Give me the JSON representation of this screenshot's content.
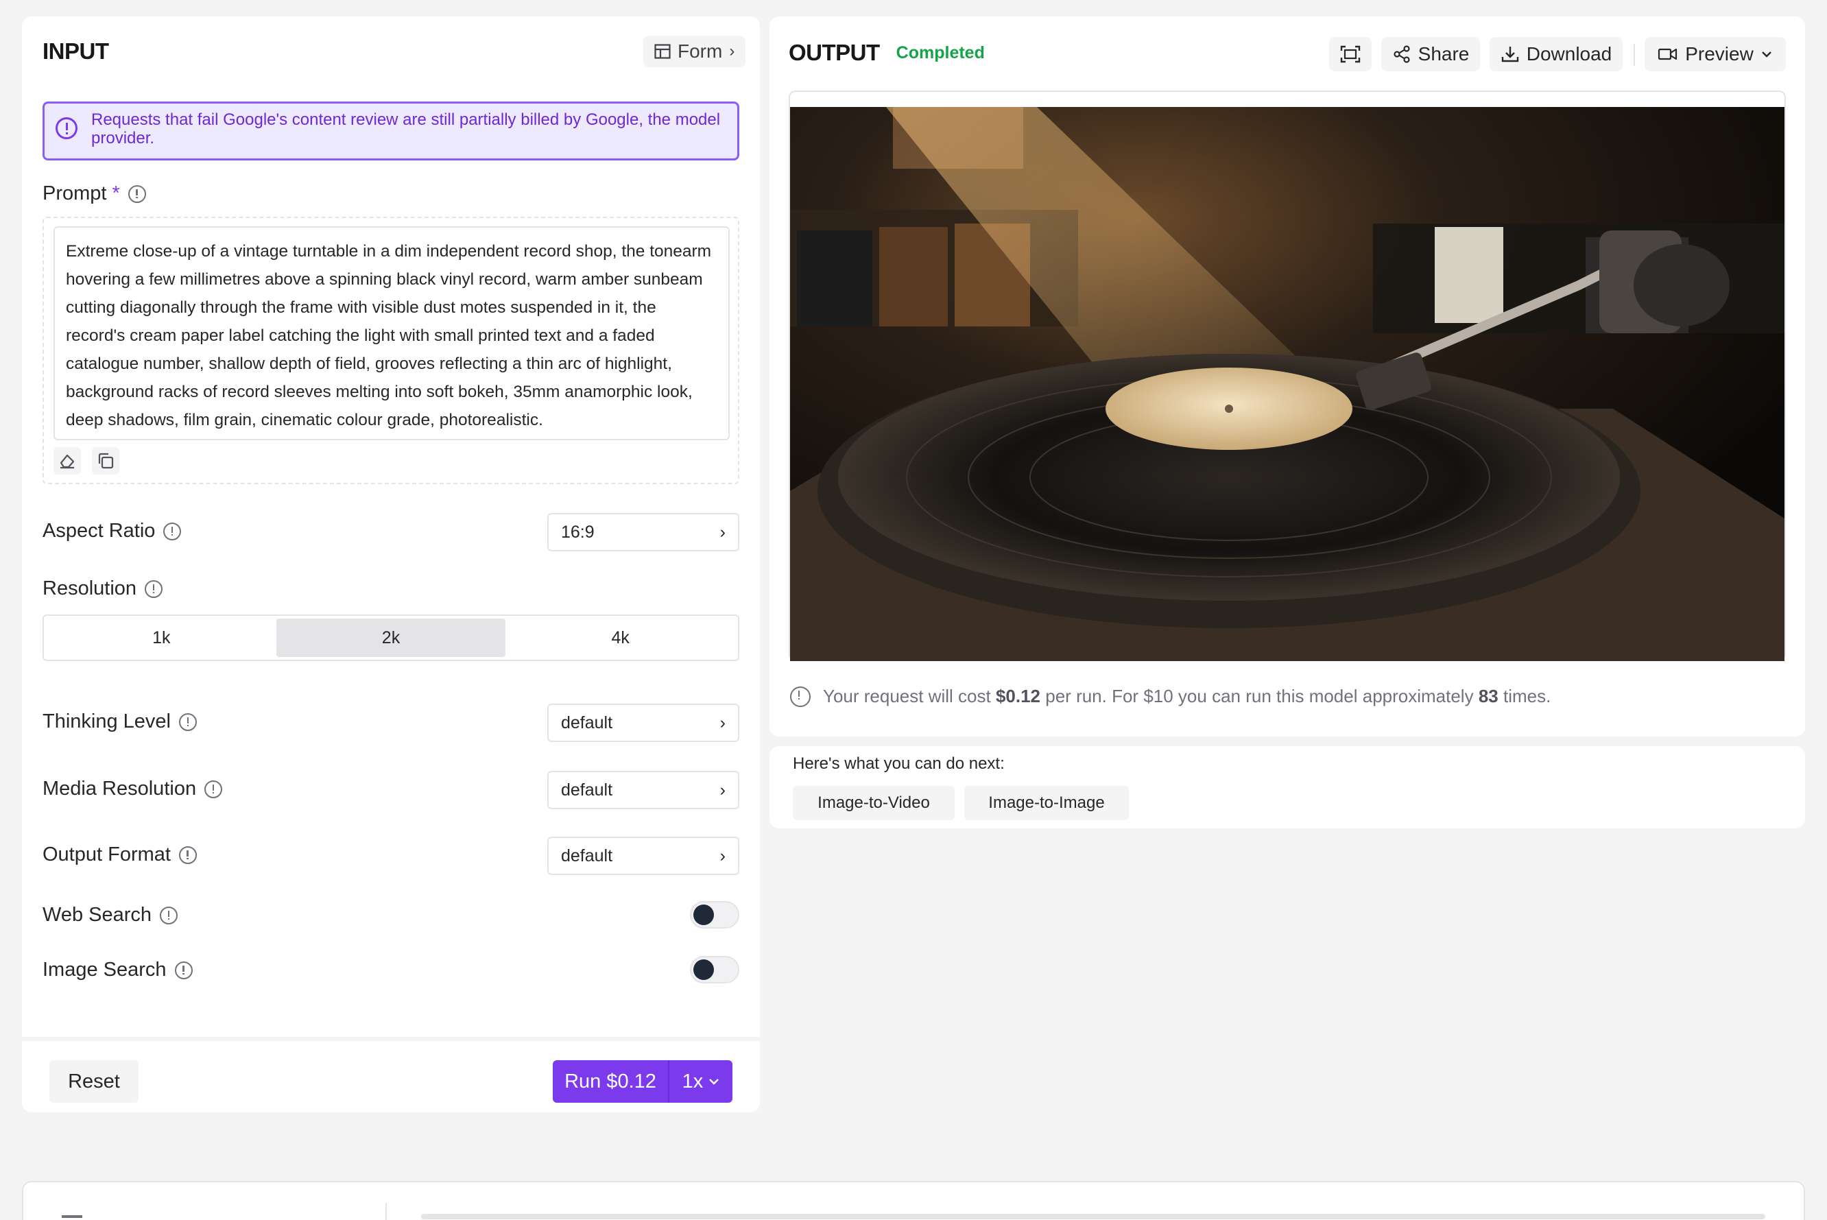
{
  "input": {
    "title": "INPUT",
    "form_button": "Form",
    "alert": "Requests that fail Google's content review are still partially billed by Google, the model provider.",
    "prompt": {
      "label": "Prompt",
      "required_mark": "*",
      "value": "Extreme close-up of a vintage turntable in a dim independent record shop, the tonearm hovering a few millimetres above a spinning black vinyl record, warm amber sunbeam cutting diagonally through the frame with visible dust motes suspended in it, the record's cream paper label catching the light with small printed text and a faded catalogue number, shallow depth of field, grooves reflecting a thin arc of highlight, background racks of record sleeves melting into soft bokeh, 35mm anamorphic look, deep shadows, film grain, cinematic colour grade, photorealistic."
    },
    "aspect_ratio": {
      "label": "Aspect Ratio",
      "value": "16:9"
    },
    "resolution": {
      "label": "Resolution",
      "options": [
        "1k",
        "2k",
        "4k"
      ],
      "selected": "2k"
    },
    "thinking_level": {
      "label": "Thinking Level",
      "value": "default"
    },
    "media_resolution": {
      "label": "Media Resolution",
      "value": "default"
    },
    "output_format": {
      "label": "Output Format",
      "value": "default"
    },
    "web_search": {
      "label": "Web Search",
      "enabled": false
    },
    "image_search": {
      "label": "Image Search",
      "enabled": false
    },
    "reset_label": "Reset",
    "run_label": "Run $0.12",
    "run_multiplier": "1x"
  },
  "output": {
    "title": "OUTPUT",
    "status": "Completed",
    "share_label": "Share",
    "download_label": "Download",
    "preview_label": "Preview",
    "cost": {
      "prefix": "Your request will cost",
      "price": "$0.12",
      "middle": "per run. For $10 you can run this model approximately",
      "runs": "83",
      "suffix": "times."
    }
  },
  "next": {
    "heading": "Here's what you can do next:",
    "actions": [
      "Image-to-Video",
      "Image-to-Image"
    ]
  },
  "colors": {
    "accent": "#7c3aed",
    "status_green": "#16a34a",
    "alert_bg": "#ede9fe"
  }
}
